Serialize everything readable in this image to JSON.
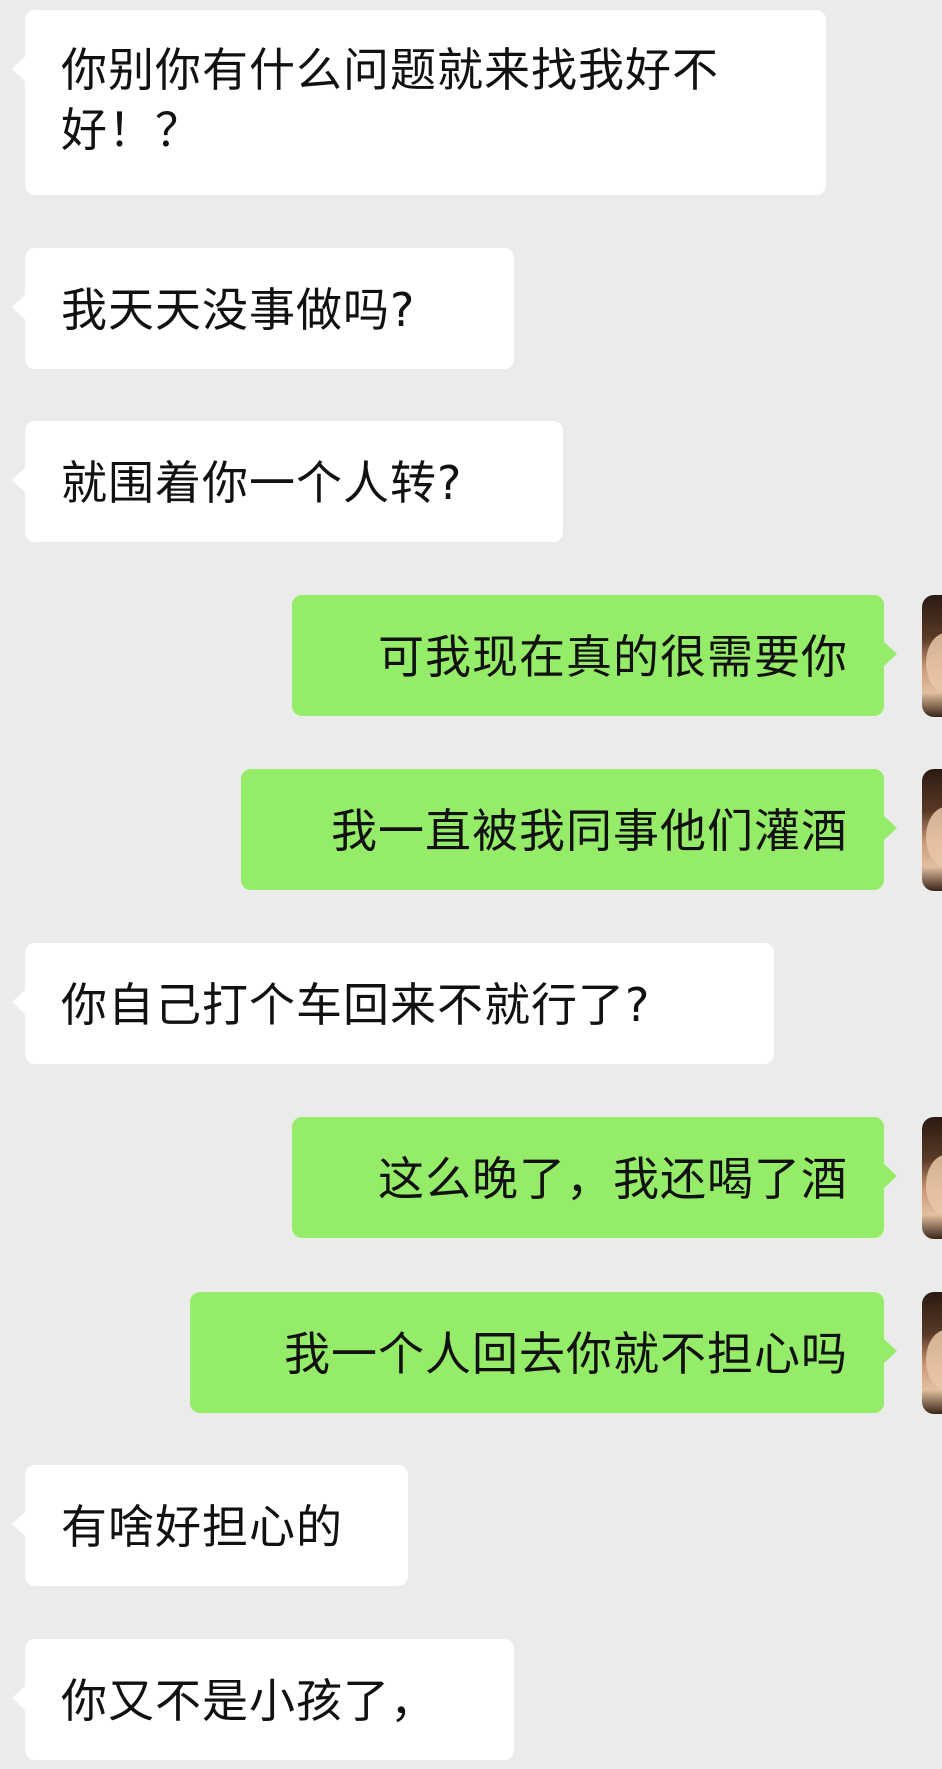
{
  "conversation": {
    "messages": [
      {
        "side": "received",
        "text_lines": [
          "你别你有什么问题就来找我好不",
          "好！？"
        ]
      },
      {
        "side": "received",
        "text_lines": [
          "我天天没事做吗?"
        ]
      },
      {
        "side": "received",
        "text_lines": [
          "就围着你一个人转?"
        ]
      },
      {
        "side": "sent",
        "text_lines": [
          "可我现在真的很需要你"
        ]
      },
      {
        "side": "sent",
        "text_lines": [
          "我一直被我同事他们灌酒"
        ]
      },
      {
        "side": "received",
        "text_lines": [
          "你自己打个车回来不就行了?"
        ]
      },
      {
        "side": "sent",
        "text_lines": [
          "这么晚了，我还喝了酒"
        ]
      },
      {
        "side": "sent",
        "text_lines": [
          "我一个人回去你就不担心吗"
        ]
      },
      {
        "side": "received",
        "text_lines": [
          "有啥好担心的"
        ]
      },
      {
        "side": "received",
        "text_lines": [
          "你又不是小孩了，"
        ]
      }
    ]
  },
  "colors": {
    "background": "#ebebeb",
    "received_bubble": "#ffffff",
    "sent_bubble": "#95ec69",
    "text": "#111111"
  },
  "icons": {
    "sender_avatar": "user-avatar-photo"
  }
}
